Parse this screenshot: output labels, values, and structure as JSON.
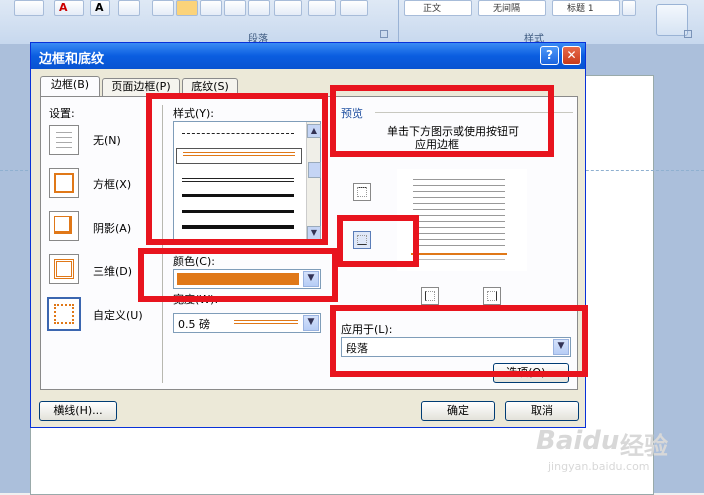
{
  "ribbon": {
    "group_labels": {
      "paragraph": "段落",
      "styles": "样式"
    },
    "style_gallery": {
      "item1": "正文",
      "item2": "无间隔",
      "item3": "标题 1"
    }
  },
  "dialog": {
    "title": "边框和底纹",
    "help_label": "?",
    "close_label": "✕",
    "tabs": [
      {
        "label": "边框(B)",
        "active": true
      },
      {
        "label": "页面边框(P)",
        "active": false
      },
      {
        "label": "底纹(S)",
        "active": false
      }
    ],
    "settings": {
      "label": "设置:",
      "options": [
        {
          "label": "无(N)"
        },
        {
          "label": "方框(X)"
        },
        {
          "label": "阴影(A)"
        },
        {
          "label": "三维(D)"
        },
        {
          "label": "自定义(U)"
        }
      ]
    },
    "style": {
      "label": "样式(Y):"
    },
    "color": {
      "label": "颜色(C):",
      "value_color": "#e07818"
    },
    "width": {
      "label": "宽度(W):",
      "value": "0.5 磅"
    },
    "preview": {
      "label": "预览",
      "hint_line1": "单击下方图示或使用按钮可",
      "hint_line2": "应用边框"
    },
    "apply_to": {
      "label": "应用于(L):",
      "value": "段落"
    },
    "options_button": "选项(O)...",
    "horizontal_line_button": "横线(H)...",
    "ok_button": "确定",
    "cancel_button": "取消"
  },
  "watermark": {
    "brand": "Baidu",
    "text": "经验",
    "url": "jingyan.baidu.com"
  },
  "colors": {
    "highlight": "#e8141e",
    "accent_line": "#e07818",
    "title_bar": "#0a5de0"
  }
}
